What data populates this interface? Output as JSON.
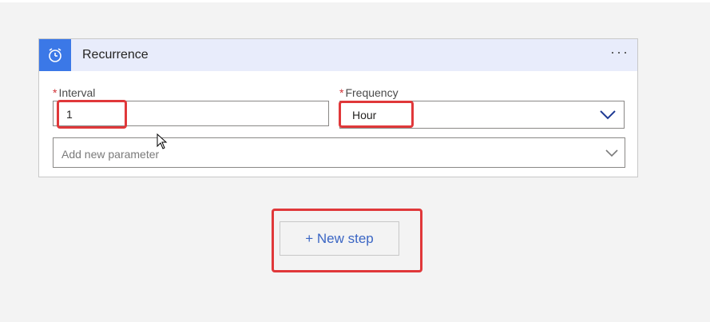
{
  "card": {
    "title": "Recurrence",
    "menu_glyph": "···",
    "icon": "alarm-clock-icon"
  },
  "fields": {
    "interval": {
      "required_mark": "*",
      "label": "Interval",
      "value": "1"
    },
    "frequency": {
      "required_mark": "*",
      "label": "Frequency",
      "value": "Hour"
    },
    "add_parameter": {
      "placeholder": "Add new parameter"
    }
  },
  "actions": {
    "new_step_label": "+ New step"
  },
  "colors": {
    "accent": "#3b78e7",
    "header_bg": "#e8ecfb",
    "highlight": "#e0383a",
    "link": "#3b66c4"
  }
}
